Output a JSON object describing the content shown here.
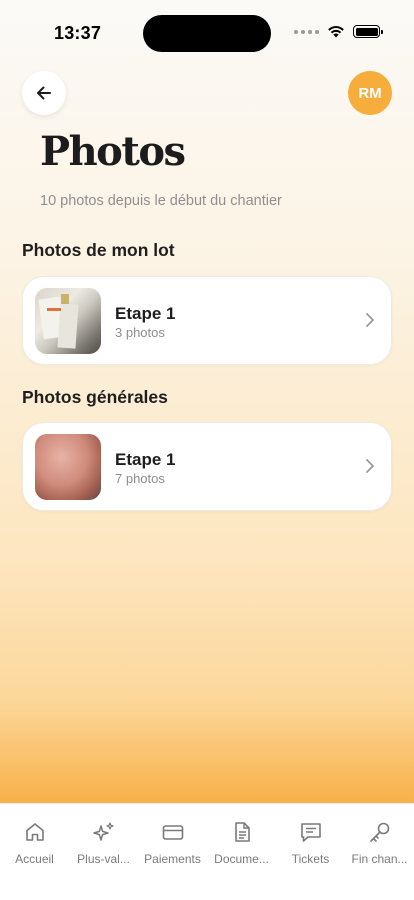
{
  "status_bar": {
    "time": "13:37"
  },
  "header": {
    "back_icon": "arrow-left-icon",
    "avatar_initials": "RM",
    "avatar_color": "#f6ad3c"
  },
  "page": {
    "title": "Photos",
    "subtitle": "10 photos depuis le début du chantier"
  },
  "sections": [
    {
      "title": "Photos de mon lot",
      "cards": [
        {
          "title": "Etape 1",
          "meta": "3 photos"
        }
      ]
    },
    {
      "title": "Photos générales",
      "cards": [
        {
          "title": "Etape 1",
          "meta": "7 photos"
        }
      ]
    }
  ],
  "tab_bar": {
    "items": [
      {
        "label": "Accueil",
        "icon": "home-icon"
      },
      {
        "label": "Plus-val...",
        "icon": "sparkles-icon"
      },
      {
        "label": "Paiements",
        "icon": "credit-card-icon"
      },
      {
        "label": "Docume...",
        "icon": "document-icon"
      },
      {
        "label": "Tickets",
        "icon": "message-icon"
      },
      {
        "label": "Fin chan...",
        "icon": "key-icon"
      }
    ]
  },
  "colors": {
    "accent": "#f6ad3c",
    "gradient_bottom": "#f8b24c"
  }
}
